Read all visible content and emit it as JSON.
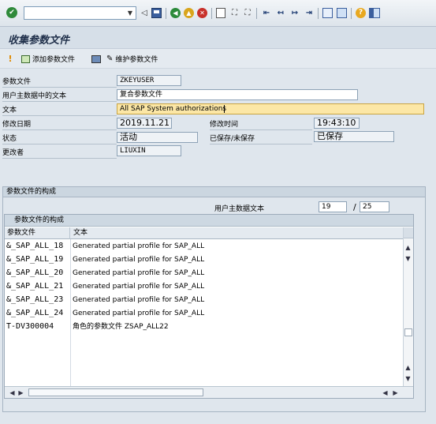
{
  "toolbar": {
    "command_field_value": "",
    "icons": [
      "check-icon",
      "back-triangle-icon",
      "save-icon",
      "back-icon",
      "exit-icon",
      "cancel-icon",
      "print-icon",
      "find-icon",
      "find-next-icon",
      "first-page-icon",
      "prev-page-icon",
      "next-page-icon",
      "last-page-icon",
      "create-session-icon",
      "shortcut-icon",
      "help-icon",
      "layout-icon"
    ]
  },
  "title": "收集参数文件",
  "app_toolbar": {
    "add_profile": "添加参数文件",
    "maintain_profile": "维护参数文件"
  },
  "form": {
    "profile_label": "参数文件",
    "profile_value": "ZKEYUSER",
    "user_master_text_label": "用户主数据中的文本",
    "user_master_text_value": "复合参数文件",
    "text_label": "文本",
    "text_value": "All SAP System authorizations",
    "changed_on_label": "修改日期",
    "changed_on_value": "2019.11.21",
    "changed_at_label": "修改时间",
    "changed_at_value": "19:43:10",
    "status_label": "状态",
    "status_value": "活动",
    "saved_label": "已保存/未保存",
    "saved_value": "已保存",
    "changed_by_label": "更改者",
    "changed_by_value": "LIUXIN"
  },
  "composition": {
    "group_title": "参数文件的构成",
    "user_master_text_label": "用户主数据文本",
    "current_entry": "19",
    "separator": "/",
    "total_entries": "25",
    "table_title": "参数文件的构成",
    "columns": [
      "参数文件",
      "文本"
    ],
    "rows": [
      {
        "profile": "&_SAP_ALL_18",
        "text": "Generated partial profile for SAP_ALL"
      },
      {
        "profile": "&_SAP_ALL_19",
        "text": "Generated partial profile for SAP_ALL"
      },
      {
        "profile": "&_SAP_ALL_20",
        "text": "Generated partial profile for SAP_ALL"
      },
      {
        "profile": "&_SAP_ALL_21",
        "text": "Generated partial profile for SAP_ALL"
      },
      {
        "profile": "&_SAP_ALL_23",
        "text": "Generated partial profile for SAP_ALL"
      },
      {
        "profile": "&_SAP_ALL_24",
        "text": "Generated partial profile for SAP_ALL"
      },
      {
        "profile": "T-DV300004",
        "text": "角色的参数文件 ZSAP_ALL22"
      }
    ]
  }
}
